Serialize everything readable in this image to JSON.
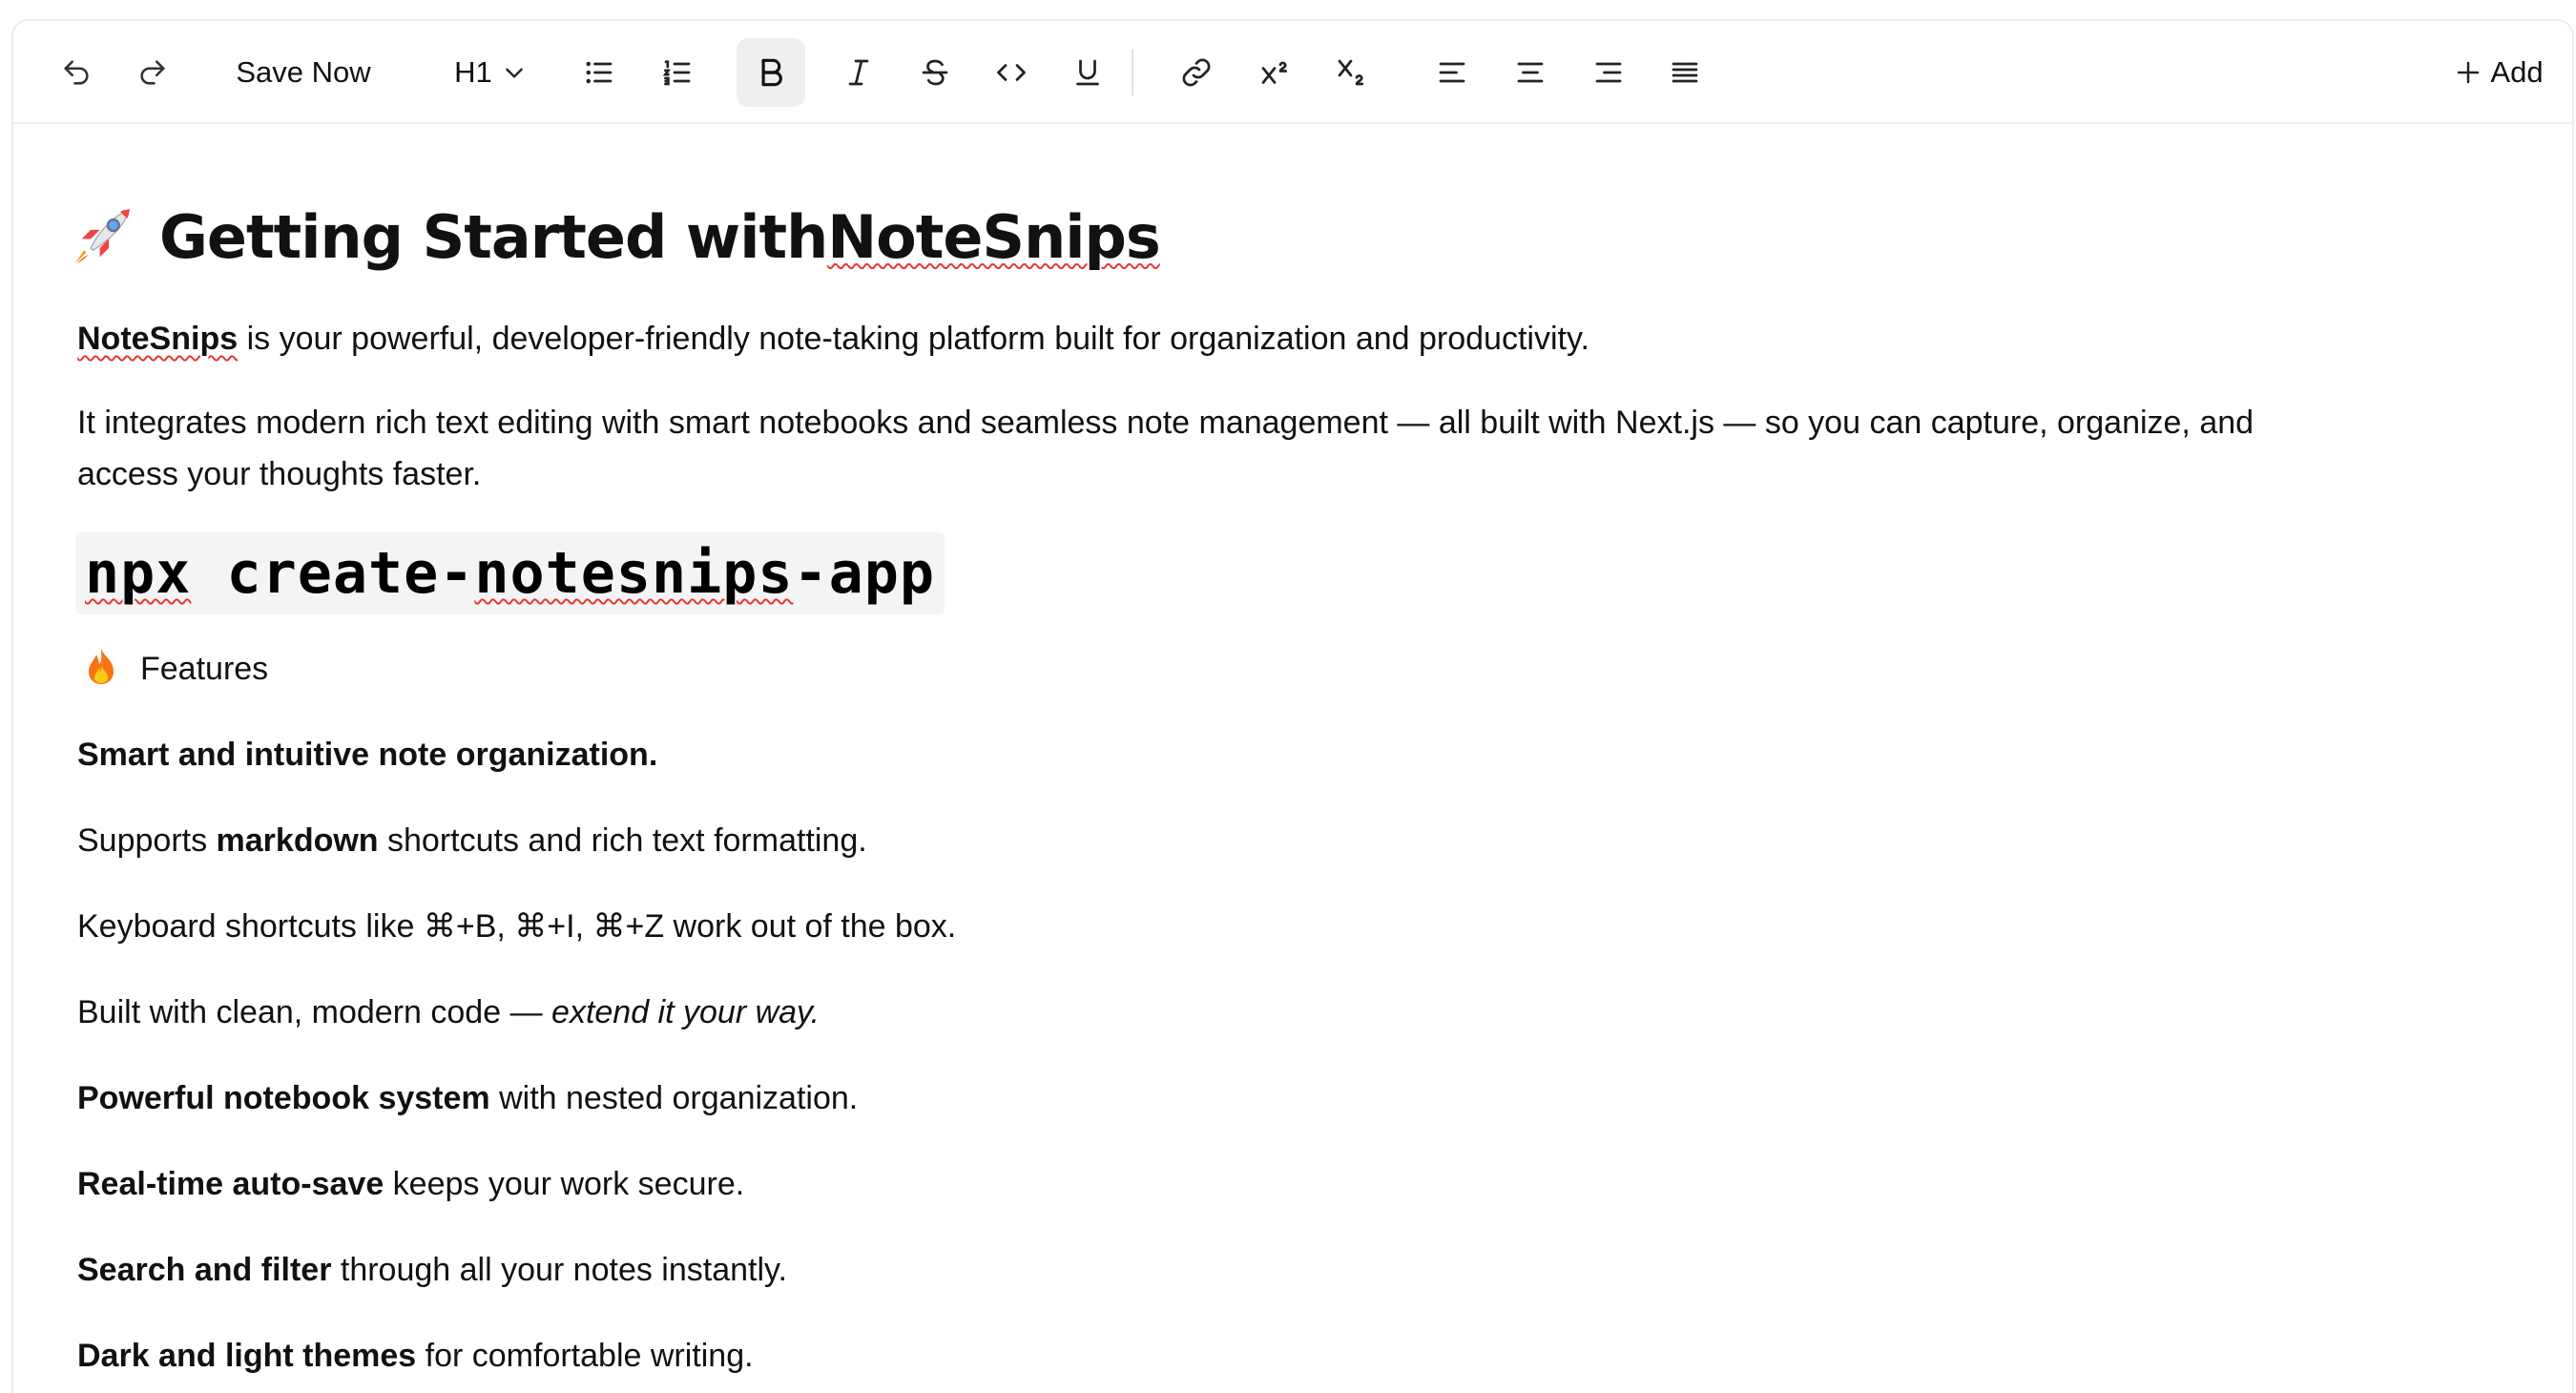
{
  "toolbar": {
    "undo_icon": "undo-icon",
    "redo_icon": "redo-icon",
    "save_label": "Save Now",
    "heading_label": "H1",
    "heading_chevron": "chevron-down-icon",
    "add_label": "Add",
    "buttons": [
      "bullet-list-icon",
      "ordered-list-icon",
      "bold-icon",
      "italic-icon",
      "strikethrough-icon",
      "code-icon",
      "underline-icon",
      "link-icon",
      "superscript-icon",
      "subscript-icon",
      "align-left-icon",
      "align-center-icon",
      "align-right-icon",
      "align-justify-icon",
      "plus-icon"
    ],
    "active_button": "bold"
  },
  "document": {
    "title": "Getting Started with NoteSnips",
    "title_emoji": "rocket",
    "intro_bold": "NoteSnips",
    "intro_rest": " is your powerful, developer-friendly note-taking platform built for organization and productivity.",
    "para2_line1": "It integrates modern rich text editing with smart notebooks and seamless note management — all built with Next.js — so you can capture, organize, and",
    "para2_line2": "access your thoughts faster.",
    "code": "npx create-notesnips-app",
    "features_emoji": "fire",
    "features_label": "Features",
    "smart": "Smart and intuitive note organization.",
    "md_before": "Supports ",
    "md_bold": "markdown",
    "md_after": " shortcuts and rich text formatting.",
    "shortcuts": "Keyboard shortcuts like ⌘+B, ⌘+I, ⌘+Z work out of the box.",
    "built_before": "Built with clean, modern code — ",
    "built_italic": "extend it your way.",
    "notebook_bold": "Powerful notebook system",
    "notebook_rest": " with nested organization.",
    "autosave_bold": "Real-time auto-save",
    "autosave_rest": " keeps your work secure.",
    "search_bold": "Search and filter",
    "search_rest": " through all your notes instantly.",
    "themes_bold": "Dark and light themes",
    "themes_rest": " for comfortable writing."
  },
  "colors": {
    "spellcheck": "#e53935",
    "active_bg": "#efefef",
    "code_bg": "#f4f4f4"
  }
}
